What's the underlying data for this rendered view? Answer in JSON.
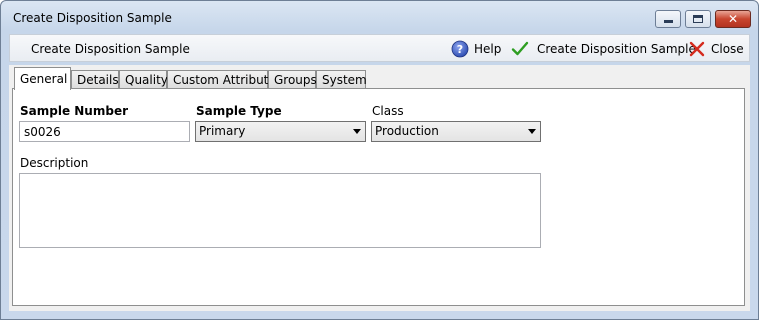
{
  "window": {
    "title": "Create Disposition Sample",
    "close_glyph": "✕"
  },
  "toolbar": {
    "title": "Create Disposition Sample",
    "help_label": "Help",
    "create_label": "Create Disposition Sample",
    "close_label": "Close",
    "help_icon": "help-circle-icon",
    "create_icon": "checkmark-icon",
    "close_icon": "red-x-icon",
    "colors": {
      "help": "#2f4fb3",
      "check": "#2e9e22",
      "close": "#d42b1e"
    }
  },
  "tabs": [
    {
      "label": "General",
      "active": true
    },
    {
      "label": "Details"
    },
    {
      "label": "Quality"
    },
    {
      "label": "Custom Attributes"
    },
    {
      "label": "Groups"
    },
    {
      "label": "System"
    }
  ],
  "form": {
    "sample_number": {
      "label": "Sample Number",
      "value": "s0026"
    },
    "sample_type": {
      "label": "Sample Type",
      "value": "Primary"
    },
    "class": {
      "label": "Class",
      "value": "Production"
    },
    "description": {
      "label": "Description",
      "value": ""
    }
  }
}
